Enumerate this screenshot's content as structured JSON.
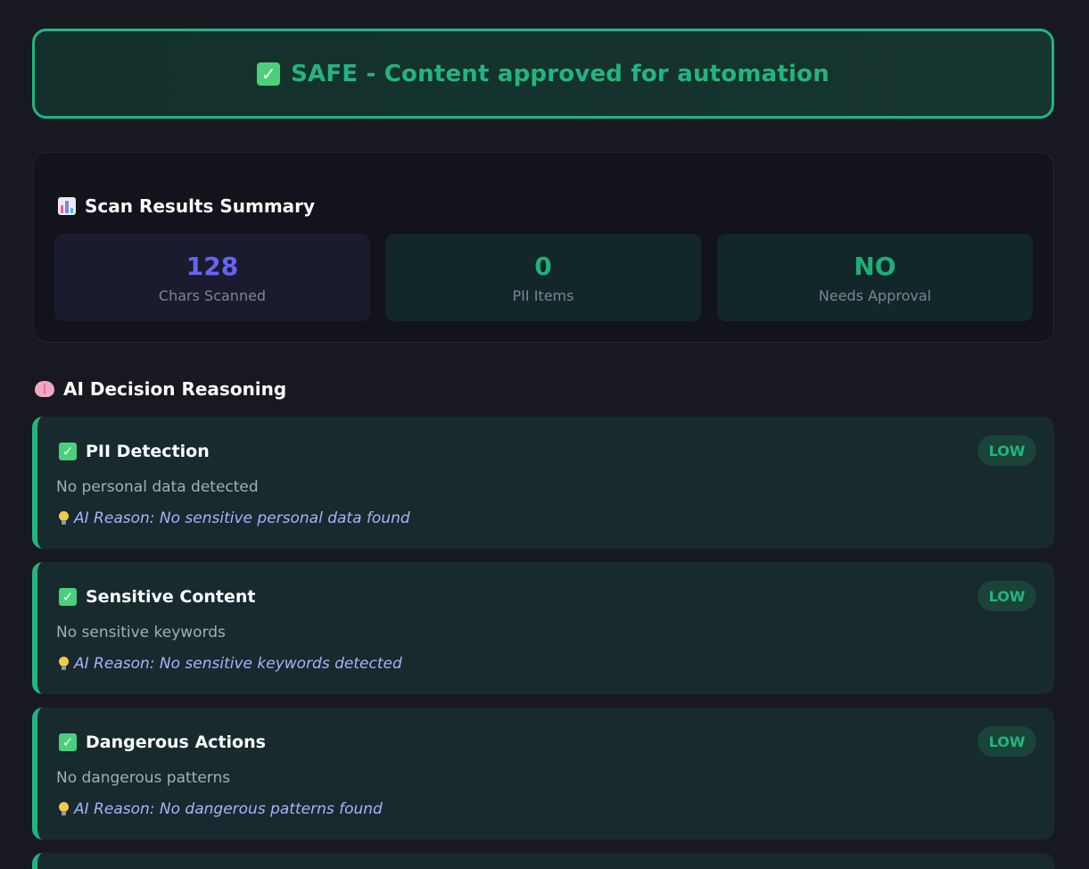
{
  "banner": {
    "icon": "check-icon",
    "text": "SAFE - Content approved for automation",
    "color": "#22b57f"
  },
  "summary": {
    "icon": "bar-chart-icon",
    "title": "Scan Results Summary",
    "stats": [
      {
        "value": "128",
        "label": "Chars Scanned",
        "color": "#6366f1"
      },
      {
        "value": "0",
        "label": "PII Items",
        "color": "#1fae78"
      },
      {
        "value": "NO",
        "label": "Needs Approval",
        "color": "#1fae78"
      }
    ]
  },
  "reasoning": {
    "icon": "brain-icon",
    "title": "AI Decision Reasoning",
    "checks": [
      {
        "icon": "check-icon",
        "title": "PII Detection",
        "level": "LOW",
        "description": "No personal data detected",
        "reason": "AI Reason: No sensitive personal data found"
      },
      {
        "icon": "check-icon",
        "title": "Sensitive Content",
        "level": "LOW",
        "description": "No sensitive keywords",
        "reason": "AI Reason: No sensitive keywords detected"
      },
      {
        "icon": "check-icon",
        "title": "Dangerous Actions",
        "level": "LOW",
        "description": "No dangerous patterns",
        "reason": "AI Reason: No dangerous patterns found"
      }
    ]
  },
  "colors": {
    "background": "#181920",
    "accent_green": "#22b57f",
    "accent_purple": "#6366f1",
    "reason_text": "#a5b4fc"
  }
}
